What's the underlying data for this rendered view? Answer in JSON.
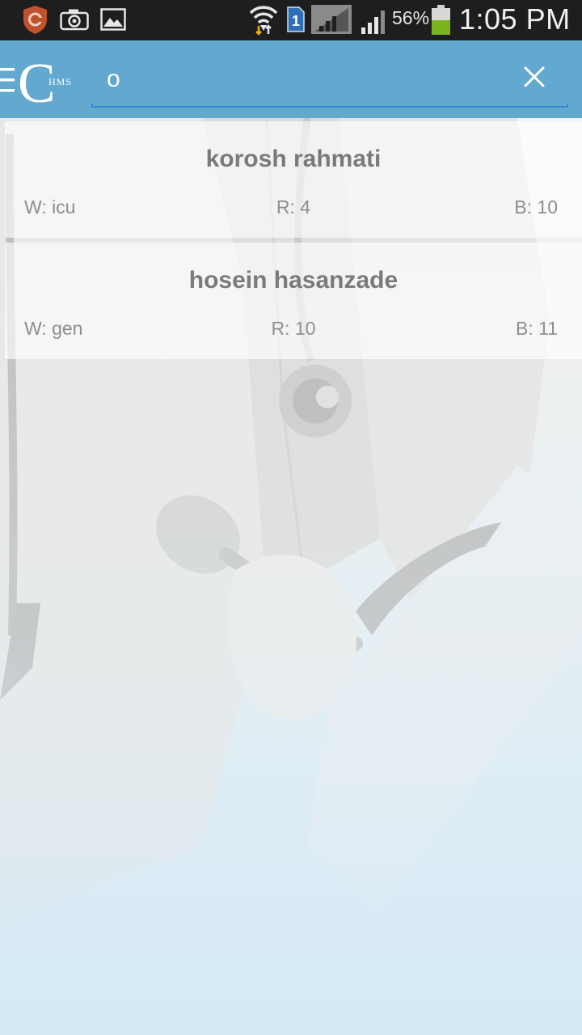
{
  "status_bar": {
    "battery_percent": "56%",
    "time": "1:05 PM",
    "sim_slot": "1",
    "icons": [
      "shield-app-icon",
      "camera-icon",
      "gallery-icon",
      "wifi-icon",
      "sim-icon",
      "signal-icon",
      "signal-icon",
      "battery-icon"
    ]
  },
  "action_bar": {
    "logo_letter": "C",
    "logo_subtext": "HMS",
    "search_value": "o",
    "accent_color": "#62a8cf",
    "underline_color": "#2f8ad0"
  },
  "results": [
    {
      "name": "korosh rahmati",
      "ward": "W: icu",
      "room": "R: 4",
      "bed": "B: 10"
    },
    {
      "name": "hosein hasanzade",
      "ward": "W: gen",
      "room": "R: 10",
      "bed": "B: 11"
    }
  ]
}
